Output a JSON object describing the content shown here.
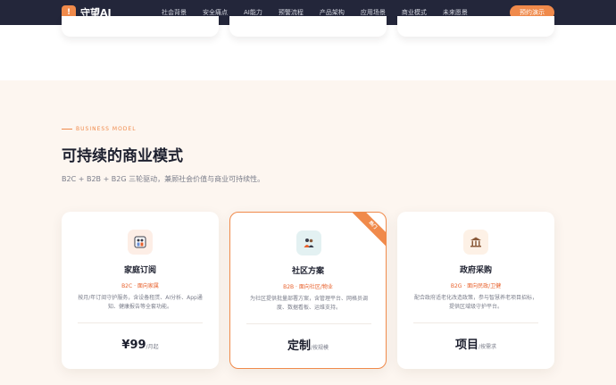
{
  "nav": {
    "logo_mark": "!",
    "brand": "守望AI",
    "items": [
      "社会背景",
      "安全痛点",
      "AI能力",
      "预警流程",
      "产品架构",
      "应用场景",
      "商业模式",
      "未来愿景"
    ],
    "cta": "预约演示"
  },
  "section": {
    "eyebrow": "BUSINESS MODEL",
    "title": "可持续的商业模式",
    "subtitle": "B2C + B2B + B2G 三轮驱动，兼顾社会价值与商业可持续性。"
  },
  "cards": [
    {
      "icon": "family-icon",
      "title": "家庭订阅",
      "tag": "B2C · 面向家属",
      "desc": "按月/年订阅守护服务，含设备租赁、AI分析、App通知、健康报告等全套功能。",
      "price": "¥99",
      "unit": "/月起"
    },
    {
      "icon": "community-icon",
      "title": "社区方案",
      "tag": "B2B · 面向社区/物业",
      "desc": "为社区提供批量部署方案，含管理平台、网格员调度、数据看板、运维支持。",
      "price": "定制",
      "unit": "/按规模",
      "ribbon": "热门"
    },
    {
      "icon": "government-icon",
      "title": "政府采购",
      "tag": "B2G · 面向民政/卫健",
      "desc": "配合政府适老化改造政策，参与智慧养老项目招标，提供区域级守护平台。",
      "price": "项目",
      "unit": "/按需求"
    }
  ],
  "colors": {
    "accent": "#f08a4b",
    "tag": "#e8612c",
    "nav_bg": "#23263a",
    "section_bg": "#fdf6f0"
  }
}
